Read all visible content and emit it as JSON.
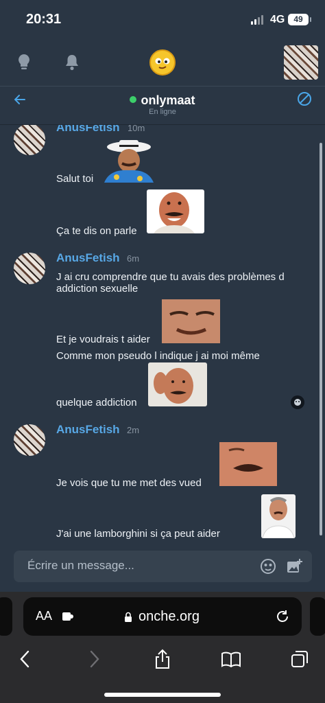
{
  "status_bar": {
    "time": "20:31",
    "network": "4G",
    "battery": "49"
  },
  "chat_header": {
    "username": "onlymaat",
    "status": "En ligne"
  },
  "messages": [
    {
      "author": "AnusFetish",
      "ago": "10m",
      "lines": [
        "Salut toi",
        "Ça te dis on parle"
      ]
    },
    {
      "author": "AnusFetish",
      "ago": "6m",
      "lines": [
        "J ai cru comprendre que tu avais des problèmes d",
        "addiction sexuelle",
        "Et je voudrais t aider",
        "Comme mon pseudo l indique j ai moi même",
        "quelque addiction"
      ]
    },
    {
      "author": "AnusFetish",
      "ago": "2m",
      "lines": [
        "Je vois que tu me met des vued",
        "J'ai une lamborghini si ça peut aider"
      ]
    }
  ],
  "composer": {
    "placeholder": "Écrire un message..."
  },
  "browser": {
    "text_size": "AA",
    "url": "onche.org"
  },
  "colors": {
    "background": "#2a3644",
    "author": "#58a8e6",
    "online": "#3ccf6a",
    "accent": "#4aa6e8"
  }
}
